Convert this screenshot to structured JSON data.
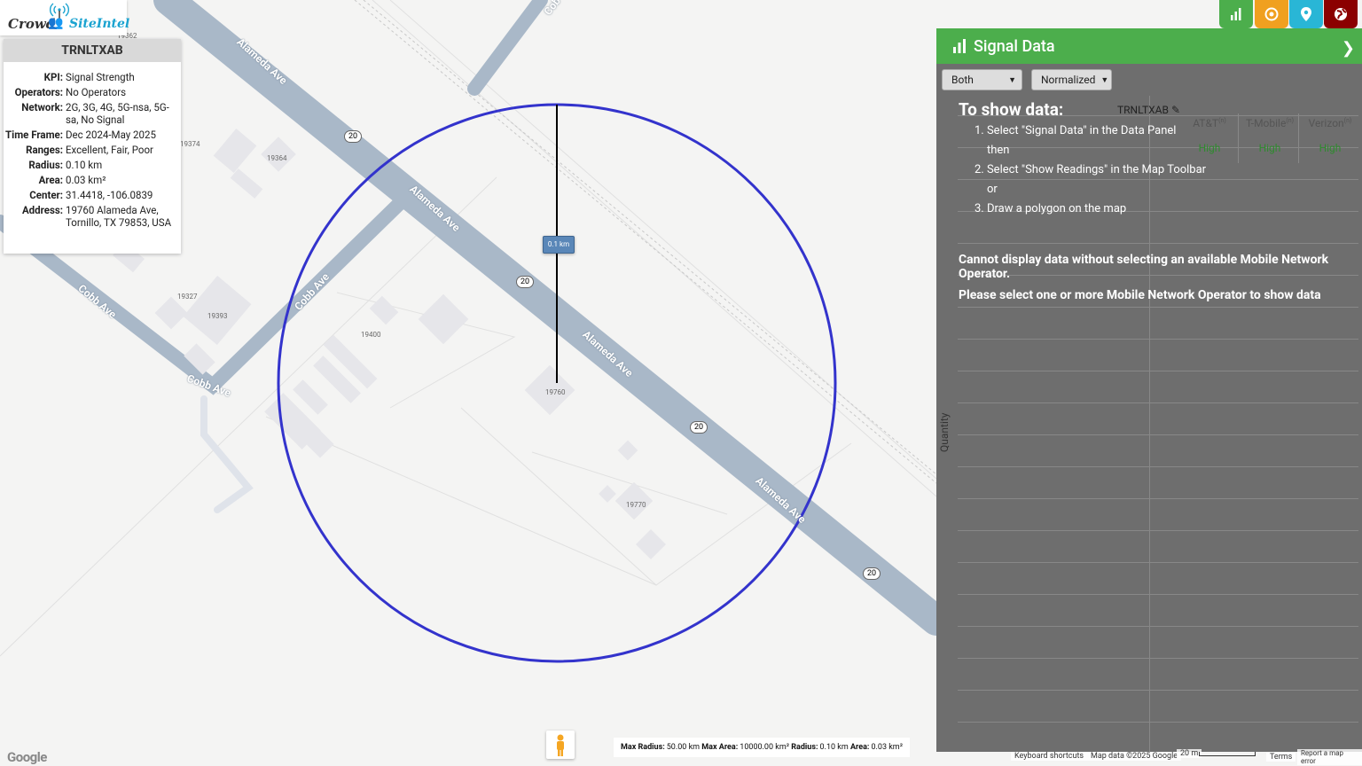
{
  "logo": {
    "crowd": "Crowd",
    "site": "SiteIntel"
  },
  "info": {
    "title": "TRNLTXAB",
    "rows": [
      {
        "k": "KPI:",
        "v": "Signal Strength"
      },
      {
        "k": "Operators:",
        "v": "No Operators"
      },
      {
        "k": "Network:",
        "v": "2G, 3G, 4G, 5G-nsa, 5G-sa, No Signal"
      },
      {
        "k": "Time Frame:",
        "v": "Dec 2024-May 2025"
      },
      {
        "k": "Ranges:",
        "v": "Excellent, Fair, Poor"
      },
      {
        "k": "Radius:",
        "v": "0.10 km"
      },
      {
        "k": "Area:",
        "v": "0.03 km²"
      },
      {
        "k": "Center:",
        "v": "31.4418, -106.0839"
      },
      {
        "k": "Address:",
        "v": "19760 Alameda Ave, Tornillo, TX 79853, USA"
      }
    ]
  },
  "map": {
    "radius_label": "0.1 km",
    "streets": [
      "Alameda Ave",
      "Alameda Ave",
      "Alameda Ave",
      "Alameda Ave",
      "Cobb Ave",
      "Cobb Ave",
      "Cobb Ave",
      "Cob"
    ],
    "route_shields": [
      "20",
      "20",
      "20",
      "20"
    ],
    "parcels": [
      "19362",
      "19374",
      "19364",
      "19327",
      "19393",
      "19400",
      "19760",
      "19770"
    ],
    "circle_color": "#3333cc"
  },
  "toolbar": {
    "buttons": [
      {
        "name": "signal-data-button",
        "icon": "bar-chart-icon",
        "color": "#4cae4c"
      },
      {
        "name": "target-button",
        "icon": "target-icon",
        "color": "#f0a020"
      },
      {
        "name": "location-button",
        "icon": "map-pin-icon",
        "color": "#29b6d6"
      },
      {
        "name": "globe-button",
        "icon": "globe-icon",
        "color": "#8b0000"
      }
    ]
  },
  "panel": {
    "title": "Signal Data",
    "select_a": "Both",
    "select_b": "Normalized",
    "site_id": "TRNLTXAB",
    "y_axis": "Quantity",
    "operators": [
      {
        "name": "AT&T",
        "sup": "(n)",
        "value": "High"
      },
      {
        "name": "T-Mobile",
        "sup": "(n)",
        "value": "High"
      },
      {
        "name": "Verizon",
        "sup": "(n)",
        "value": "High"
      }
    ],
    "howto_title": "To show data:",
    "howto": [
      "1. Select \"Signal Data\" in the Data Panel",
      "then",
      "2. Select \"Show Readings\" in the Map Toolbar",
      "or",
      "3. Draw a polygon on the map"
    ],
    "warning_1": "Cannot display data without selecting an available Mobile Network Operator.",
    "warning_2": "Please select one or more Mobile Network Operator to show data"
  },
  "status": {
    "max_radius_label": "Max Radius:",
    "max_radius": "50.00 km",
    "max_area_label": "Max Area:",
    "max_area": "10000.00 km²",
    "radius_label": "Radius:",
    "radius": "0.10 km",
    "area_label": "Area:",
    "area": "0.03 km²"
  },
  "attribution": {
    "google": "Google",
    "keyboard": "Keyboard shortcuts",
    "map_data": "Map data ©2025 Google",
    "scale": "20 m",
    "terms": "Terms",
    "report": "Report a map error"
  }
}
